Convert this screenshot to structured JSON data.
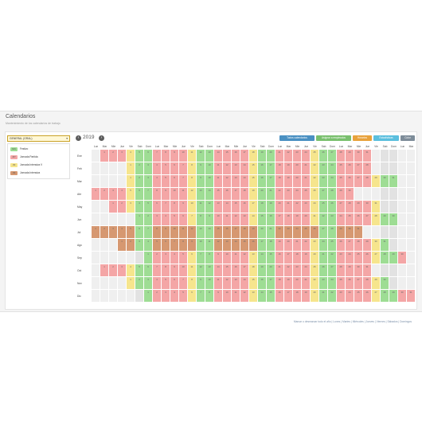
{
  "header": {
    "title": "Calendarios",
    "subtitle": "Mantenimiento de los calendarios de trabajo"
  },
  "calendar_select": {
    "value": "GENERAL (GRAL)"
  },
  "legend": [
    {
      "code": "FES",
      "label": "Festivo",
      "color": "#9edd94"
    },
    {
      "code": "JNT",
      "label": "Jornada Partida",
      "color": "#f4a6a6"
    },
    {
      "code": "JNI",
      "label": "Jornada Intensiva V",
      "color": "#f6e58d"
    },
    {
      "code": "JNI",
      "label": "Jornada Intensiva",
      "color": "#d69871"
    }
  ],
  "year": "2019",
  "toolbar": [
    {
      "label": "Todos calendarios",
      "color": "#4a90c2"
    },
    {
      "label": "Asignar a empleados",
      "color": "#7ac06e"
    },
    {
      "label": "Horarios",
      "color": "#e8a23c"
    },
    {
      "label": "Estadísticas",
      "color": "#5bbfde"
    },
    {
      "label": "Color",
      "color": "#7d8c99"
    }
  ],
  "weekday_headers": [
    "Lun",
    "Mar",
    "Mie",
    "Jue",
    "Vie",
    "Sab",
    "Dom"
  ],
  "months": [
    "Ene",
    "Feb",
    "Mar",
    "Abr",
    "May",
    "Jun",
    "Jul",
    "Ago",
    "Sep",
    "Oct",
    "Nov",
    "Dic"
  ],
  "colors": {
    "festivo": "#9edd94",
    "partida": "#f4a6a6",
    "intensiva_v": "#f6e58d",
    "intensiva": "#d69871",
    "empty": "#efefef",
    "weekend_empty": "#e2e2e2"
  },
  "footer": "Marcar o desmarcar todo el año | Lunes | Martes | Miércoles | Jueves | Viernes | Sábados | Domingos"
}
